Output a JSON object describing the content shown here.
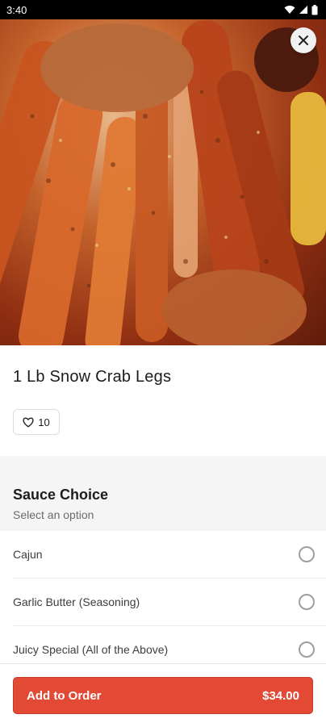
{
  "status_bar": {
    "time": "3:40"
  },
  "item": {
    "name": "1 Lb Snow Crab Legs",
    "likes": "10"
  },
  "sauce": {
    "title": "Sauce Choice",
    "subtitle": "Select an option",
    "options": [
      {
        "label": "Cajun"
      },
      {
        "label": "Garlic Butter (Seasoning)"
      },
      {
        "label": "Juicy Special (All of the Above)"
      }
    ]
  },
  "footer": {
    "add_label": "Add to Order",
    "price": "$34.00"
  },
  "colors": {
    "accent": "#e24a36",
    "section_bg": "#f5f5f5"
  },
  "icons": {
    "close": "close-icon",
    "heart": "heart-icon"
  }
}
